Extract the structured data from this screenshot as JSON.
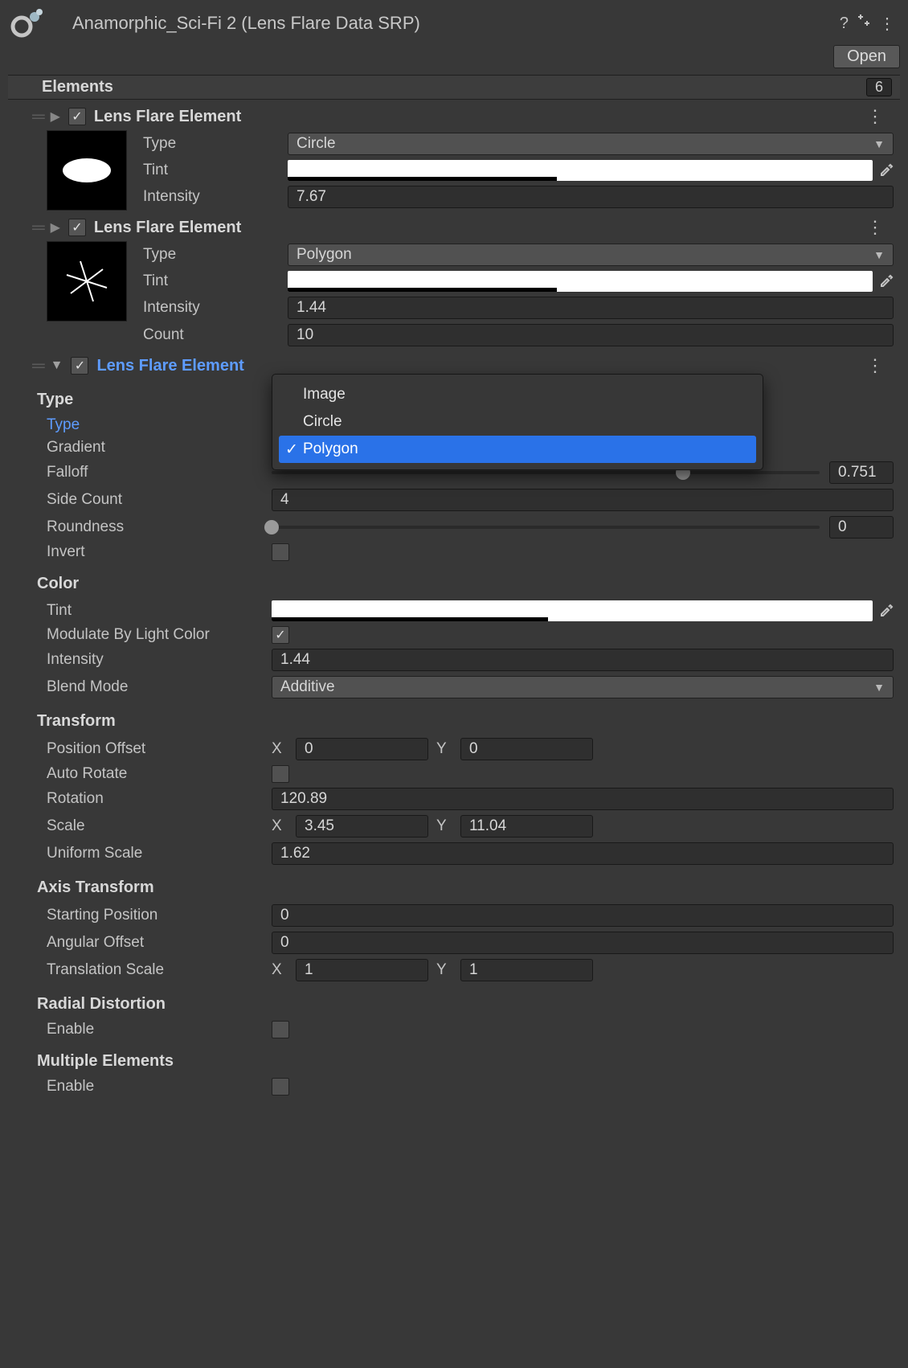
{
  "header": {
    "title": "Anamorphic_Sci-Fi 2 (Lens Flare Data SRP)",
    "open_label": "Open"
  },
  "section": {
    "title": "Elements",
    "count": "6"
  },
  "el1": {
    "header": "Lens Flare Element",
    "type_label": "Type",
    "type_value": "Circle",
    "tint_label": "Tint",
    "intensity_label": "Intensity",
    "intensity_value": "7.67"
  },
  "el2": {
    "header": "Lens Flare Element",
    "type_label": "Type",
    "type_value": "Polygon",
    "tint_label": "Tint",
    "intensity_label": "Intensity",
    "intensity_value": "1.44",
    "count_label": "Count",
    "count_value": "10"
  },
  "el3": {
    "header": "Lens Flare Element",
    "type_section": "Type",
    "type_label": "Type",
    "gradient_label": "Gradient",
    "falloff_label": "Falloff",
    "falloff_value": "0.751",
    "sidecount_label": "Side Count",
    "sidecount_value": "4",
    "roundness_label": "Roundness",
    "roundness_value": "0",
    "invert_label": "Invert",
    "color_section": "Color",
    "tint_label": "Tint",
    "modulate_label": "Modulate By Light Color",
    "intensity_label": "Intensity",
    "intensity_value": "1.44",
    "blend_label": "Blend Mode",
    "blend_value": "Additive",
    "transform_section": "Transform",
    "posoff_label": "Position Offset",
    "posoff_x": "0",
    "posoff_y": "0",
    "autorotate_label": "Auto Rotate",
    "rotation_label": "Rotation",
    "rotation_value": "120.89",
    "scale_label": "Scale",
    "scale_x": "3.45",
    "scale_y": "11.04",
    "uscale_label": "Uniform Scale",
    "uscale_value": "1.62",
    "axis_section": "Axis Transform",
    "startpos_label": "Starting Position",
    "startpos_value": "0",
    "angoff_label": "Angular Offset",
    "angoff_value": "0",
    "tscale_label": "Translation Scale",
    "tscale_x": "1",
    "tscale_y": "1",
    "radial_section": "Radial Distortion",
    "enable1_label": "Enable",
    "multi_section": "Multiple Elements",
    "enable2_label": "Enable"
  },
  "popup": {
    "items": [
      "Image",
      "Circle",
      "Polygon"
    ],
    "selected": "Polygon"
  },
  "xy_labels": {
    "x": "X",
    "y": "Y"
  }
}
